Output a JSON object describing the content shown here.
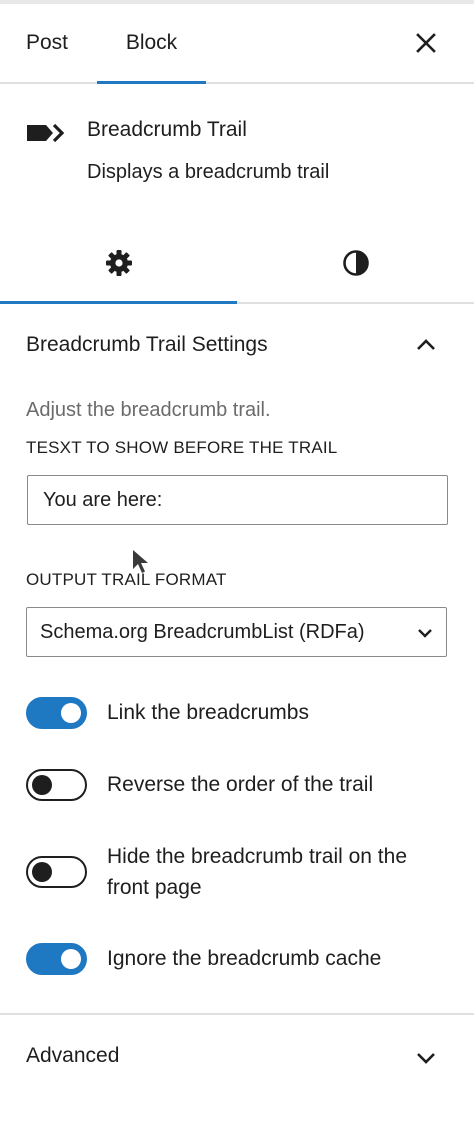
{
  "tabs": {
    "post_label": "Post",
    "block_label": "Block",
    "active": "Block"
  },
  "block": {
    "icon": "breadcrumb-arrows-icon",
    "title": "Breadcrumb Trail",
    "description": "Displays a breadcrumb trail"
  },
  "subtabs": {
    "settings_icon": "gear-icon",
    "styles_icon": "half-circle-contrast-icon",
    "active": "settings"
  },
  "panel": {
    "title": "Breadcrumb Trail Settings",
    "expanded": true,
    "description": "Adjust the breadcrumb trail.",
    "before_label": "TESXT TO SHOW BEFORE THE TRAIL",
    "before_value": "You are here:",
    "format_label": "OUTPUT TRAIL FORMAT",
    "format_value": "Schema.org BreadcrumbList (RDFa)"
  },
  "toggles": [
    {
      "label": "Link the breadcrumbs",
      "checked": true
    },
    {
      "label": "Reverse the order of the trail",
      "checked": false
    },
    {
      "label": "Hide the breadcrumb trail on the front page",
      "checked": false
    },
    {
      "label": "Ignore the breadcrumb cache",
      "checked": true
    }
  ],
  "advanced": {
    "title": "Advanced",
    "expanded": false
  },
  "colors": {
    "accent": "#1e78c2",
    "text": "#1e1e1e",
    "muted": "#6b6b6b",
    "border": "#e0e0e0"
  }
}
